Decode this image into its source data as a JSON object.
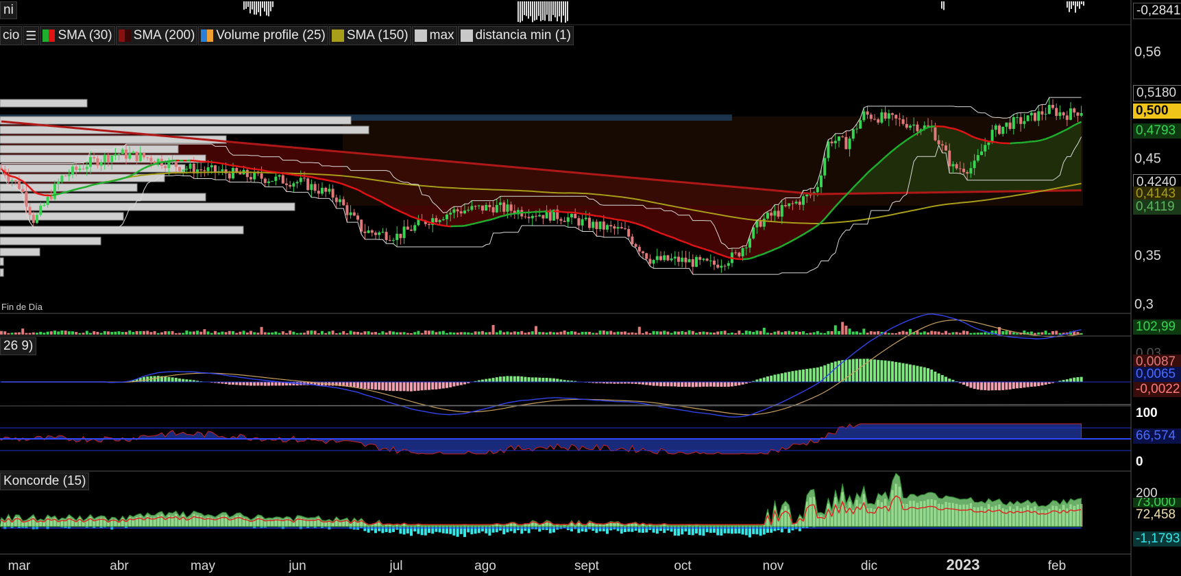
{
  "top_label": "ni",
  "legend": {
    "prefix": "cio",
    "list_icon": "list-icon",
    "items": [
      {
        "label": "SMA (30)",
        "c1": "#1fae2d",
        "c2": "#e01414"
      },
      {
        "label": "SMA (200)",
        "c1": "#8a0f0f",
        "c2": "#3a0606"
      },
      {
        "label": "Volume profile (25)",
        "c1": "#2a7fd6",
        "c2": "#f0a030"
      },
      {
        "label": "SMA (150)",
        "c1": "#a89e1a",
        "c2": "#a89e1a"
      },
      {
        "label": "max",
        "c1": "#c8c8c8",
        "c2": "#c8c8c8"
      },
      {
        "label": "distancia min (1)",
        "c1": "#c8c8c8",
        "c2": "#c8c8c8"
      }
    ]
  },
  "fin_de_dia": "Fin de Día",
  "macd_label": "26 9)",
  "koncorde_label": "Koncorde (15)",
  "colors": {
    "up": "#39d353",
    "down": "#e07a7a",
    "sma30_up": "#1fae2d",
    "sma30_down": "#e01414",
    "sma200": "#b01818",
    "sma150": "#a89e1a",
    "price_tag": "#f0c419"
  },
  "right_axis": {
    "top_value": "-0,2841",
    "ticks": [
      "0,56",
      "0,45",
      "0,35",
      "0,3"
    ],
    "tags": {
      "max": "0,5180",
      "price": "0,500",
      "sma30": "0,4793",
      "min": "0,4240",
      "sma150": "0,4143",
      "sma200": "0,4119"
    },
    "volume": "102,99",
    "macd": [
      "0,0087",
      "0,0065",
      "-0,0022"
    ],
    "macd_top_hidden": "0,03",
    "rsi_top": "100",
    "rsi_bottom": "0",
    "rsi_value": "66,574",
    "koncorde_top": "200",
    "koncorde_values": [
      "73,000",
      "72,458",
      "-1,1793"
    ]
  },
  "chart_data": {
    "type": "candlestick",
    "x_axis_labels": [
      "mar",
      "abr",
      "may",
      "jun",
      "jul",
      "ago",
      "sept",
      "oct",
      "nov",
      "dic",
      "2023",
      "feb"
    ],
    "price_range": [
      0.3,
      0.56
    ],
    "close_series_approx": [
      {
        "date": "mar",
        "close": 0.44
      },
      {
        "date": "abr",
        "close": 0.455
      },
      {
        "date": "may",
        "close": 0.44
      },
      {
        "date": "jun",
        "close": 0.425
      },
      {
        "date": "jul",
        "close": 0.375
      },
      {
        "date": "ago",
        "close": 0.395
      },
      {
        "date": "sept",
        "close": 0.39
      },
      {
        "date": "oct",
        "close": 0.345
      },
      {
        "date": "nov",
        "close": 0.37
      },
      {
        "date": "dic",
        "close": 0.49
      },
      {
        "date": "2023",
        "close": 0.44
      },
      {
        "date": "feb",
        "close": 0.5
      }
    ],
    "indicators": [
      "SMA (30)",
      "SMA (200)",
      "SMA (150)",
      "Volume profile (25)",
      "max",
      "distancia min (1)"
    ],
    "subpanels": [
      "volume",
      "MACD",
      "RSI",
      "Koncorde (15)"
    ]
  }
}
